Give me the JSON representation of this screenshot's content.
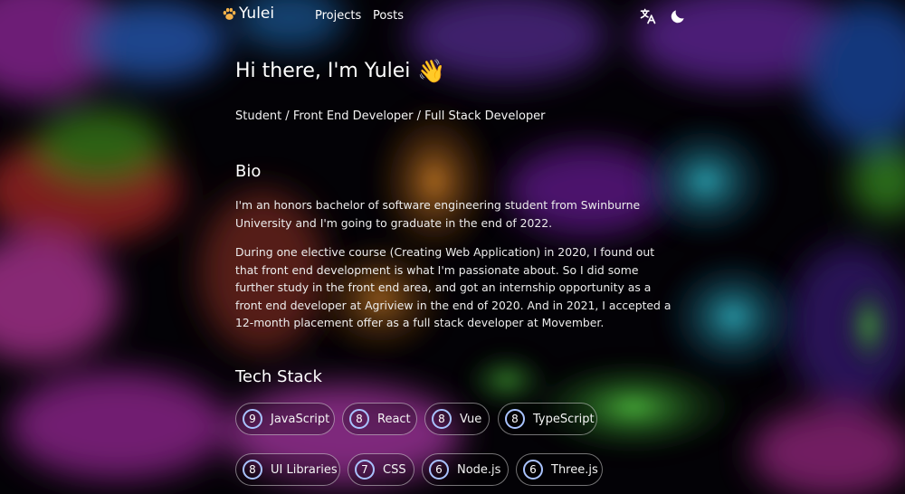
{
  "nav": {
    "logo_text": "Yulei",
    "links": [
      "Projects",
      "Posts"
    ]
  },
  "hero": {
    "greeting": "Hi there, I'm Yulei",
    "wave_emoji": "👋",
    "roles": "Student / Front End Developer / Full Stack Developer"
  },
  "bio": {
    "heading": "Bio",
    "paragraphs": [
      "I'm an honors bachelor of software engineering student from Swinburne University and I'm going to graduate in the end of 2022.",
      "During one elective course (Creating Web Application) in 2020, I found out that front end development is what I'm passionate about. So I did some further study in the front end area, and got an internship opportunity as a front end developer at Agriview in the end of 2020. And in 2021, I accepted a 12-month placement offer as a full stack developer at Movember."
    ]
  },
  "tech": {
    "heading": "Tech Stack",
    "items": [
      {
        "count": "9",
        "label": "JavaScript"
      },
      {
        "count": "8",
        "label": "React"
      },
      {
        "count": "8",
        "label": "Vue"
      },
      {
        "count": "8",
        "label": "TypeScript"
      },
      {
        "count": "8",
        "label": "UI Libraries"
      },
      {
        "count": "7",
        "label": "CSS"
      },
      {
        "count": "6",
        "label": "Node.js"
      },
      {
        "count": "6",
        "label": "Three.js"
      }
    ]
  },
  "icons": {
    "logo": "paw-icon",
    "language": "translate-icon",
    "theme": "moon-icon"
  },
  "colors": {
    "badge_ring": "#a9c3ff",
    "background": "#050308"
  }
}
